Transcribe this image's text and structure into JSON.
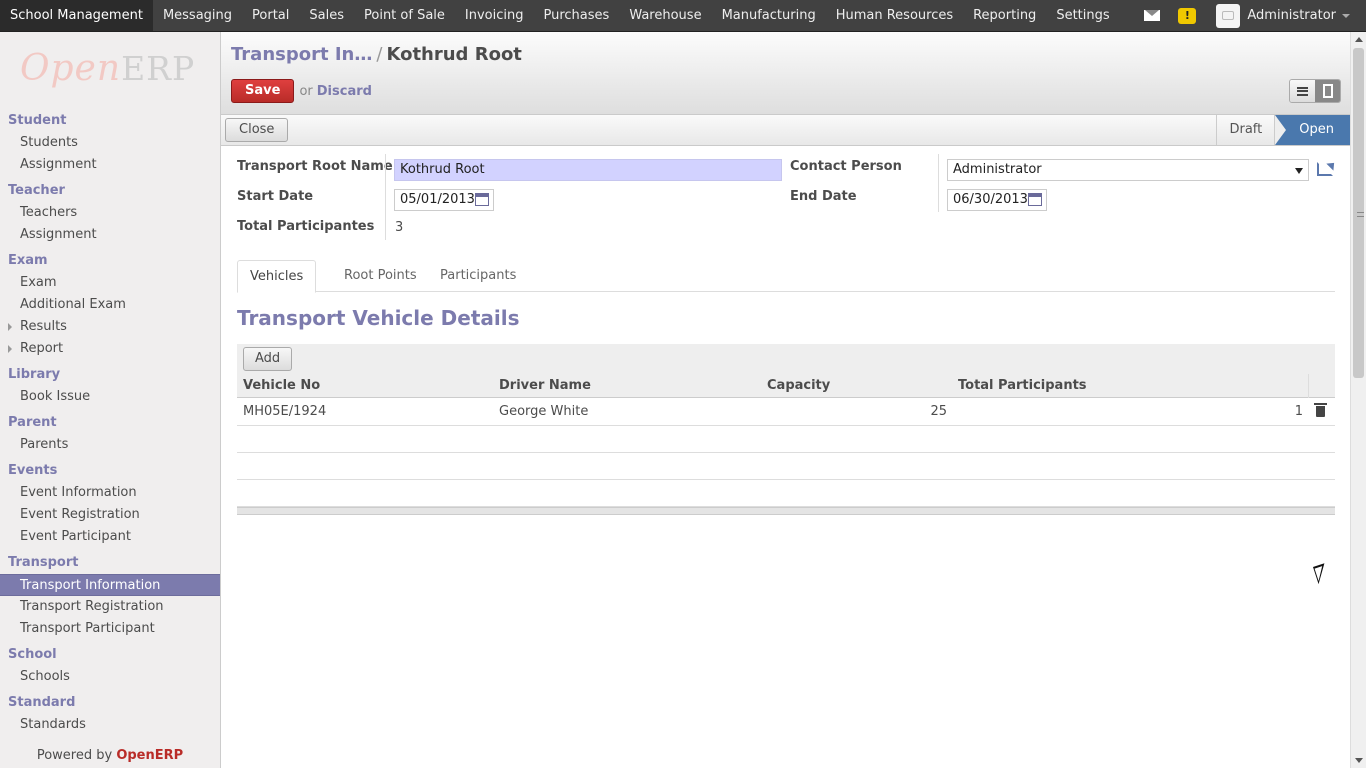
{
  "topbar": {
    "menu": [
      {
        "label": "School Management",
        "active": true
      },
      {
        "label": "Messaging"
      },
      {
        "label": "Portal"
      },
      {
        "label": "Sales"
      },
      {
        "label": "Point of Sale"
      },
      {
        "label": "Invoicing"
      },
      {
        "label": "Purchases"
      },
      {
        "label": "Warehouse"
      },
      {
        "label": "Manufacturing"
      },
      {
        "label": "Human Resources"
      },
      {
        "label": "Reporting"
      },
      {
        "label": "Settings"
      }
    ],
    "user_name": "Administrator",
    "warning_glyph": "!",
    "icons": {
      "mail": "mail-icon",
      "warning": "warning-icon",
      "user": "avatar",
      "dropdown": "chevron-down-icon"
    }
  },
  "sidebar": {
    "logo_open": "Open",
    "logo_erp": "ERP",
    "sections": [
      {
        "title": "Student",
        "items": [
          {
            "label": "Students"
          },
          {
            "label": "Assignment"
          }
        ]
      },
      {
        "title": "Teacher",
        "items": [
          {
            "label": "Teachers"
          },
          {
            "label": "Assignment"
          }
        ]
      },
      {
        "title": "Exam",
        "items": [
          {
            "label": "Exam"
          },
          {
            "label": "Additional Exam"
          },
          {
            "label": "Results",
            "expandable": true
          },
          {
            "label": "Report",
            "expandable": true
          }
        ]
      },
      {
        "title": "Library",
        "items": [
          {
            "label": "Book Issue"
          }
        ]
      },
      {
        "title": "Parent",
        "items": [
          {
            "label": "Parents"
          }
        ]
      },
      {
        "title": "Events",
        "items": [
          {
            "label": "Event Information"
          },
          {
            "label": "Event Registration"
          },
          {
            "label": "Event Participant"
          }
        ]
      },
      {
        "title": "Transport",
        "items": [
          {
            "label": "Transport Information",
            "active": true
          },
          {
            "label": "Transport Registration"
          },
          {
            "label": "Transport Participant"
          }
        ]
      },
      {
        "title": "School",
        "items": [
          {
            "label": "Schools"
          }
        ]
      },
      {
        "title": "Standard",
        "items": [
          {
            "label": "Standards"
          }
        ]
      }
    ],
    "powered_prefix": "Powered by ",
    "powered_brand": "OpenERP"
  },
  "header": {
    "breadcrumb_parent": "Transport In…",
    "breadcrumb_sep": "/",
    "breadcrumb_current": "Kothrud Root",
    "save_label": "Save",
    "or_label": "or",
    "discard_label": "Discard"
  },
  "statusbar": {
    "close_label": "Close",
    "stages": [
      {
        "label": "Draft"
      },
      {
        "label": "Open",
        "current": true
      }
    ]
  },
  "form": {
    "root_name_label": "Transport Root Name",
    "root_name_value": "Kothrud Root",
    "contact_label": "Contact Person",
    "contact_value": "Administrator",
    "start_date_label": "Start Date",
    "start_date_value": "05/01/2013",
    "end_date_label": "End Date",
    "end_date_value": "06/30/2013",
    "total_label": "Total Participantes",
    "total_value": "3"
  },
  "tabs": [
    {
      "label": "Vehicles",
      "active": true
    },
    {
      "label": "Root Points"
    },
    {
      "label": "Participants"
    }
  ],
  "vehicles": {
    "title": "Transport Vehicle Details",
    "add_label": "Add",
    "columns": [
      "Vehicle No",
      "Driver Name",
      "Capacity",
      "Total Participants"
    ],
    "rows": [
      {
        "vehicle_no": "MH05E/1924",
        "driver": "George White",
        "capacity": "25",
        "total": "1"
      }
    ]
  },
  "colors": {
    "topbar": "#414141",
    "accent": "#7c7bad",
    "save": "#b92c28",
    "stage_current": "#4a78ad",
    "required_field": "#d2d2ff"
  }
}
